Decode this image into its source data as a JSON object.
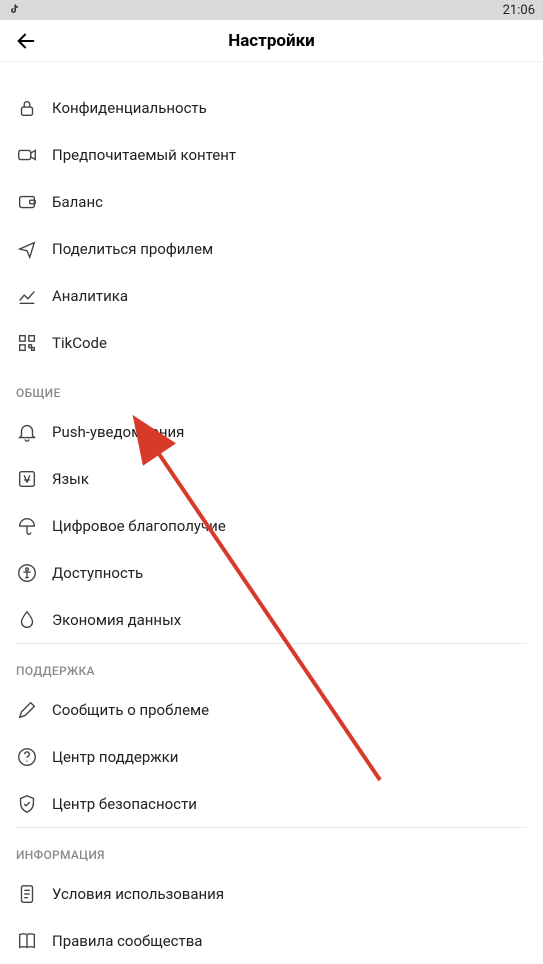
{
  "status_bar": {
    "time": "21:06"
  },
  "header": {
    "title": "Настройки"
  },
  "sections": {
    "account": {
      "items": {
        "privacy": "Конфиденциальность",
        "contentPref": "Предпочитаемый контент",
        "balance": "Баланс",
        "shareProfile": "Поделиться профилем",
        "analytics": "Аналитика",
        "tikcode": "TikCode"
      }
    },
    "general": {
      "header": "ОБЩИЕ",
      "items": {
        "push": "Push-уведомления",
        "language": "Язык",
        "wellbeing": "Цифровое благополучие",
        "accessibility": "Доступность",
        "dataSaver": "Экономия данных"
      }
    },
    "support": {
      "header": "ПОДДЕРЖКА",
      "items": {
        "report": "Сообщить о проблеме",
        "helpCenter": "Центр поддержки",
        "safety": "Центр безопасности"
      }
    },
    "info": {
      "header": "ИНФОРМАЦИЯ",
      "items": {
        "terms": "Условия использования",
        "guidelines": "Правила сообщества"
      }
    }
  }
}
